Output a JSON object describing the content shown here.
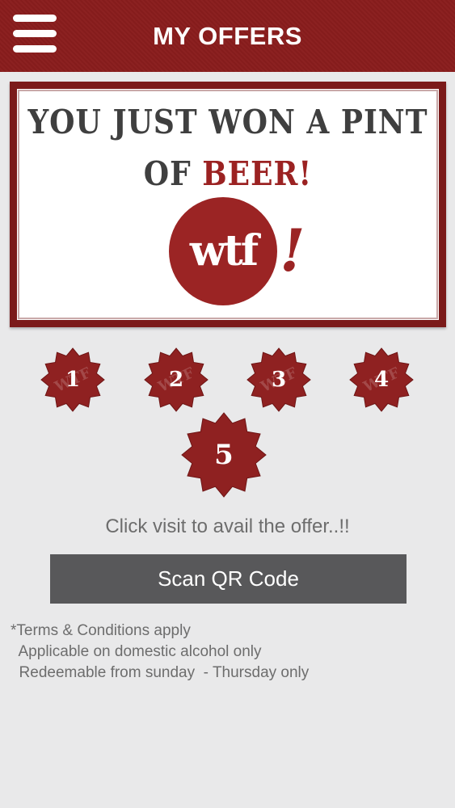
{
  "header": {
    "title": "MY OFFERS",
    "menu_icon": "hamburger-icon",
    "background_color": "#8a1d1d"
  },
  "banner": {
    "line1": "YOU JUST WON A PINT",
    "line2_prefix": "OF ",
    "line2_highlight": "BEER!",
    "logo_text": "wtf",
    "logo_bang": "!",
    "accent_color": "#9b2424"
  },
  "stamps": [
    {
      "number": "1",
      "watermark": "WTF"
    },
    {
      "number": "2",
      "watermark": "WTF"
    },
    {
      "number": "3",
      "watermark": "WTF"
    },
    {
      "number": "4",
      "watermark": "WTF"
    },
    {
      "number": "5",
      "watermark": ""
    }
  ],
  "instruction": "Click visit to avail the offer..!!",
  "scan_button": {
    "label": "Scan QR Code"
  },
  "terms": {
    "line1": "*Terms & Conditions apply",
    "line2": "  Applicable on domestic alcohol only",
    "line3": "  Redeemable from sunday  - Thursday only"
  }
}
